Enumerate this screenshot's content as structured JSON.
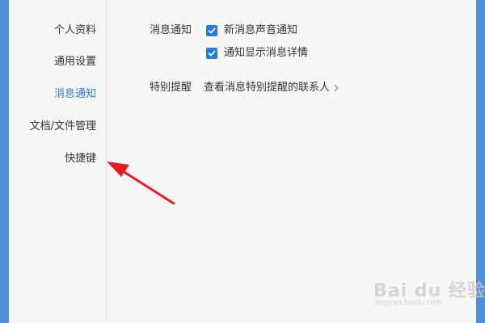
{
  "sidebar": {
    "items": [
      {
        "label": "个人资料"
      },
      {
        "label": "通用设置"
      },
      {
        "label": "消息通知",
        "active": true
      },
      {
        "label": "文档/文件管理"
      },
      {
        "label": "快捷键"
      }
    ]
  },
  "notifications": {
    "section_label": "消息通知",
    "options": [
      {
        "label": "新消息声音通知",
        "checked": true
      },
      {
        "label": "通知显示消息详情",
        "checked": true
      }
    ]
  },
  "special_reminder": {
    "section_label": "特别提醒",
    "link_label": "查看消息特别提醒的联系人"
  },
  "watermark": {
    "logo": "Bai du 经验",
    "url": "jingyan.baidu.com"
  },
  "colors": {
    "accent": "#2b7bd6",
    "annotation_arrow": "#e02020",
    "window_bg": "#f7f7f7",
    "frame_bg": "#4f8fd6"
  },
  "icons": {
    "checkbox": "check-icon",
    "link": "chevron-right-icon",
    "annotation": "red-arrow"
  }
}
